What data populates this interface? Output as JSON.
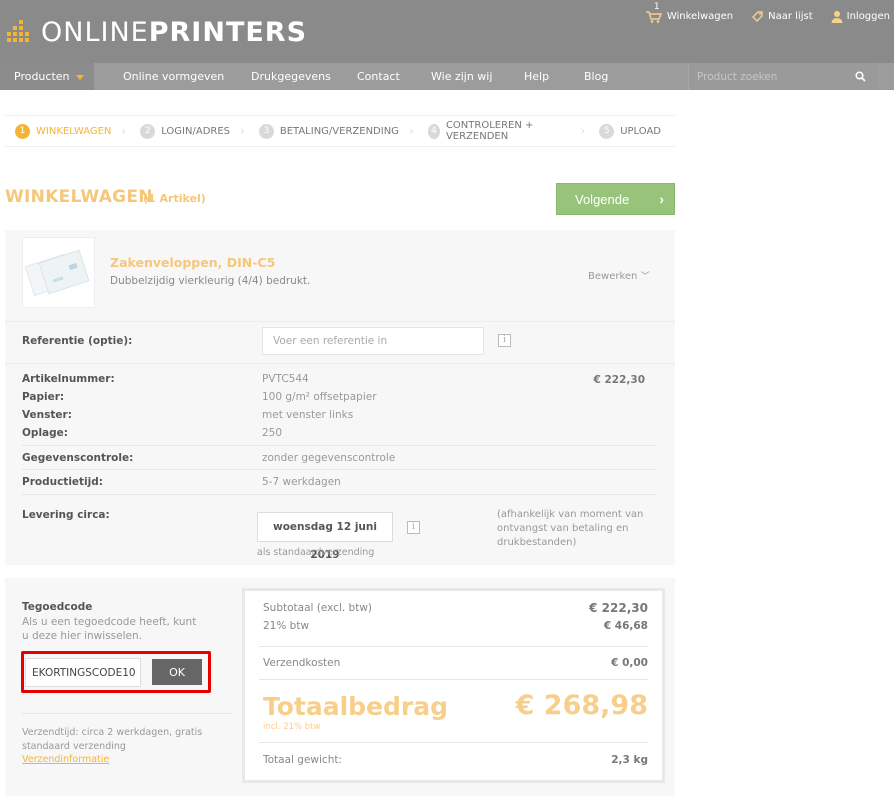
{
  "header": {
    "logo_thin": "ONLINE",
    "logo_bold": "PRINTERS",
    "cart_count": "1",
    "links": {
      "cart": "Winkelwagen",
      "wishlist": "Naar lijst",
      "login": "Inloggen"
    }
  },
  "nav": {
    "products": "Producten",
    "design": "Online vormgeven",
    "print_data": "Drukgegevens",
    "contact": "Contact",
    "about": "Wie zijn wij",
    "help": "Help",
    "blog": "Blog",
    "search_placeholder": "Product zoeken"
  },
  "steps": [
    {
      "num": "1",
      "label": "WINKELWAGEN"
    },
    {
      "num": "2",
      "label": "LOGIN/ADRES"
    },
    {
      "num": "3",
      "label": "BETALING/VERZENDING"
    },
    {
      "num": "4",
      "label": "CONTROLEREN + VERZENDEN"
    },
    {
      "num": "5",
      "label": "UPLOAD"
    }
  ],
  "cart": {
    "title": "WINKELWAGEN",
    "count": "(1 Artikel)",
    "next_label": "Volgende"
  },
  "product": {
    "name": "Zakenveloppen, DIN-C5",
    "description": "Dubbelzijdig vierkleurig (4/4) bedrukt.",
    "edit_label": "Bewerken",
    "reference_label": "Referentie (optie):",
    "reference_placeholder": "Voer een referentie in",
    "article_label": "Artikelnummer:",
    "article_value": "PVTC544",
    "paper_label": "Papier:",
    "paper_value": "100 g/m² offsetpapier",
    "window_label": "Venster:",
    "window_value": "met venster links",
    "run_label": "Oplage:",
    "run_value": "250",
    "price": "€ 222,30",
    "datacheck_label": "Gegevenscontrole:",
    "datacheck_value": "zonder gegevenscontrole",
    "production_label": "Productietijd:",
    "production_value": "5-7 werkdagen",
    "delivery_label": "Levering circa:",
    "delivery_date": "woensdag 12 juni 2019",
    "delivery_type": "als standaardverzending",
    "delivery_note": "(afhankelijk van moment van ontvangst van betaling en drukbestanden)"
  },
  "voucher": {
    "title": "Tegoedcode",
    "text": "Als u een tegoedcode heeft, kunt u deze hier inwisselen.",
    "code_value": "EKORTINGSCODE10",
    "ok_label": "OK",
    "shipping_info": "Verzendtijd: circa 2 werkdagen, gratis standaard verzending",
    "shipping_link": "Verzendinformatie"
  },
  "summary": {
    "subtotal_label": "Subtotaal (excl. btw)",
    "subtotal_value": "€ 222,30",
    "vat_label": "21% btw",
    "vat_value": "€ 46,68",
    "shipping_label": "Verzendkosten",
    "shipping_value": "€ 0,00",
    "total_label": "Totaalbedrag",
    "total_sub": "incl. 21% btw",
    "total_value": "€ 268,98",
    "weight_label": "Totaal gewicht:",
    "weight_value": "2,3 kg"
  },
  "colors": {
    "accent": "#f5b533",
    "next_button": "#97c47a",
    "highlight_box": "#e60000"
  }
}
